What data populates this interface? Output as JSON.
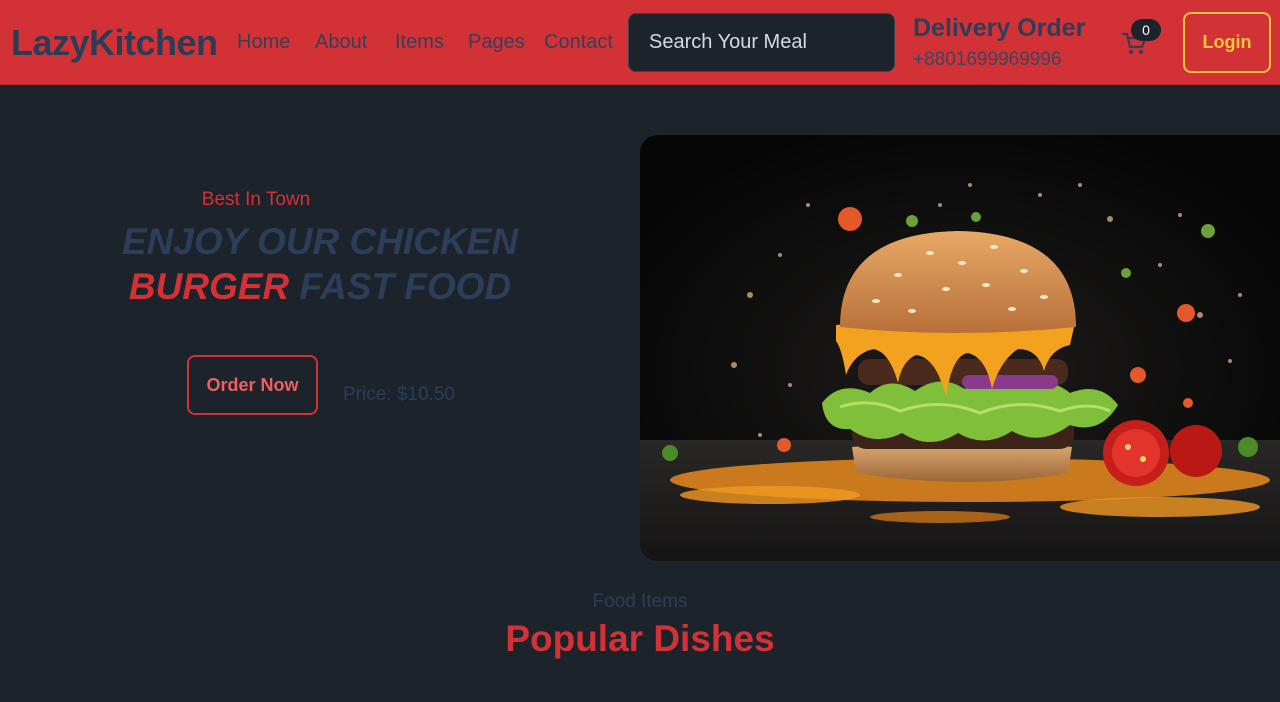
{
  "brand": "LazyKitchen",
  "nav": {
    "links": [
      "Home",
      "About",
      "Items",
      "Pages",
      "Contact"
    ]
  },
  "search": {
    "placeholder": "Search Your Meal"
  },
  "delivery": {
    "title": "Delivery Order",
    "phone": "+8801699969996"
  },
  "cart": {
    "icon": "cart-icon",
    "count": "0"
  },
  "login_label": "Login",
  "hero": {
    "eyebrow": "Best In Town",
    "title_line1": "ENJOY OUR CHICKEN",
    "title_accent": "BURGER",
    "title_rest": "FAST FOOD",
    "order_button": "Order Now",
    "price": "Price: $10.50"
  },
  "section": {
    "eyebrow": "Food Items",
    "title": "Popular Dishes"
  },
  "colors": {
    "navbar": "#d23235",
    "page_background": "#1d232a",
    "accent_red": "#d23235",
    "heading_blue": "#2c3e5a",
    "login_gold": "#f5c542"
  }
}
